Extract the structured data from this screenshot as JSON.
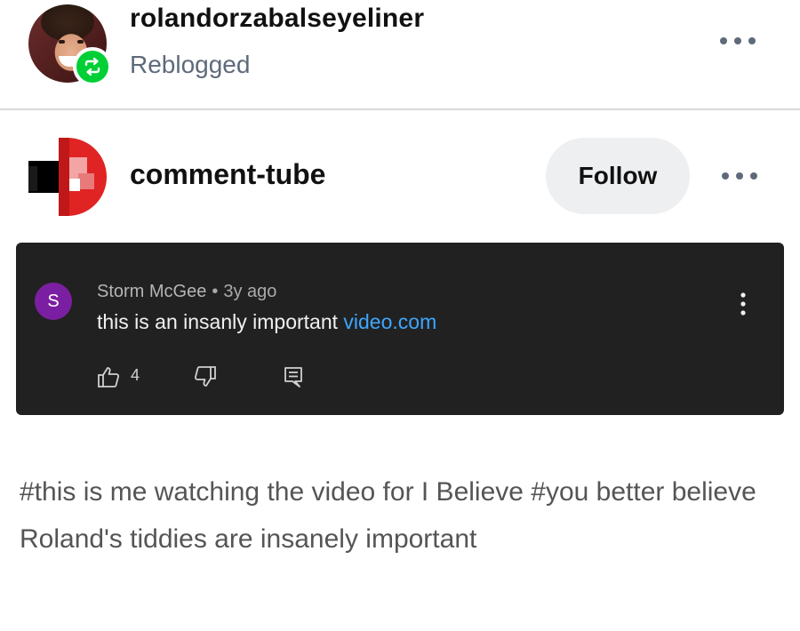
{
  "reblog_header": {
    "username": "rolandorzabalseyeliner",
    "status": "Reblogged",
    "avatar_icon": "user-avatar",
    "badge_icon": "reblog-icon",
    "badge_color": "#00cf35"
  },
  "post": {
    "blog_name": "comment-tube",
    "follow_label": "Follow",
    "more_icon": "more-horizontal-icon"
  },
  "comment": {
    "author_initial": "S",
    "author": "Storm McGee",
    "separator": "•",
    "time": "3y ago",
    "text": "this is an insanly important ",
    "link": "video.com",
    "like_count": "4",
    "avatar_color": "#7b1fa2",
    "link_color": "#3ea6ff"
  },
  "tags": [
    "#this is me watching the video for I Believe",
    "#you better believe Roland's tiddies are insanely important"
  ]
}
